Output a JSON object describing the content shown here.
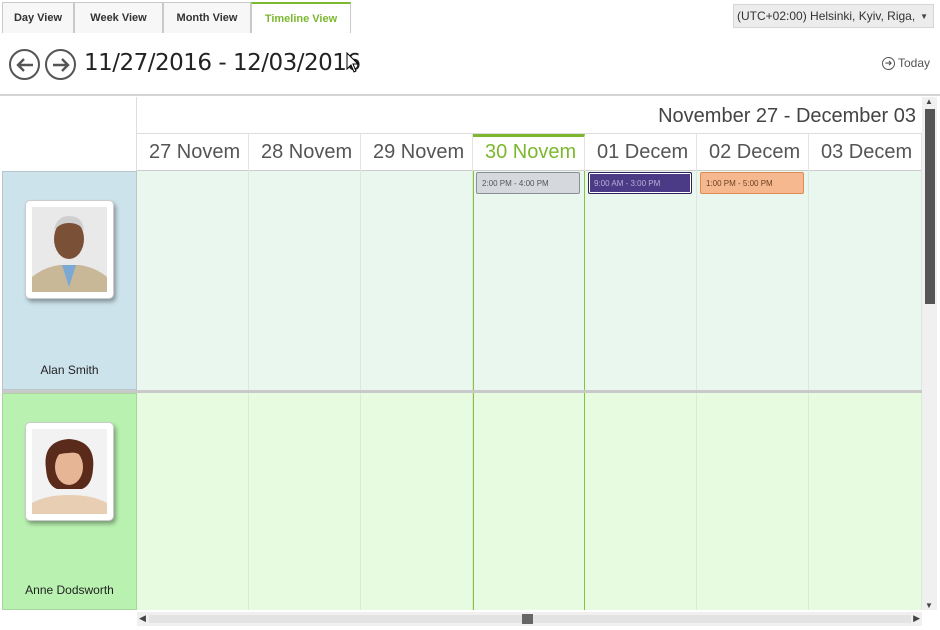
{
  "tabs": [
    {
      "label": "Day View",
      "active": false
    },
    {
      "label": "Week View",
      "active": false
    },
    {
      "label": "Month View",
      "active": false
    },
    {
      "label": "Timeline View",
      "active": true
    }
  ],
  "timezone": {
    "selected": "(UTC+02:00) Helsinki, Kyiv, Riga,"
  },
  "nav": {
    "prev_icon": "arrow-left-circle-icon",
    "next_icon": "arrow-right-circle-icon",
    "range_label": "11/27/2016 - 12/03/2016",
    "today_label": "Today"
  },
  "timeline": {
    "range_header": "November 27 - December 03",
    "days": [
      "27 Novem",
      "28 Novem",
      "29 Novem",
      "30 Novem",
      "01 Decem",
      "02 Decem",
      "03 Decem"
    ],
    "today_index": 3
  },
  "resources": [
    {
      "name": "Alan Smith",
      "row_color": "#cde3ec",
      "cell_color": "#e9f7ee"
    },
    {
      "name": "Anne Dodsworth",
      "row_color": "#b9f2b0",
      "cell_color": "#e6fbe0"
    }
  ],
  "appointments": [
    {
      "text": "2:00 PM - 4:00 PM",
      "day_index": 3,
      "bg": "#d5d9de",
      "border": "#8a8f96",
      "color": "#555"
    },
    {
      "text": "9:00 AM - 3:00 PM",
      "day_index": 4,
      "bg": "#4b3a86",
      "border": "#2d2160",
      "color": "#b8b0d8"
    },
    {
      "text": "1:00 PM - 5:00 PM",
      "day_index": 5,
      "bg": "#f6b98f",
      "border": "#e08a56",
      "color": "#6a3f22"
    }
  ],
  "colors": {
    "accent": "#7cb82f"
  }
}
